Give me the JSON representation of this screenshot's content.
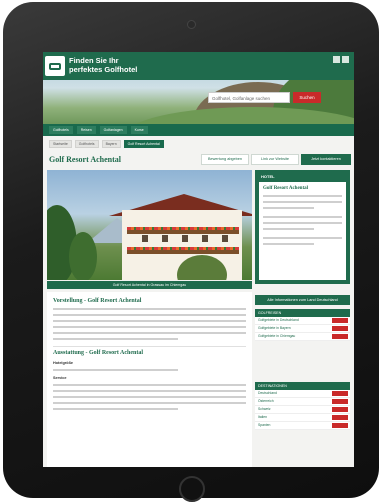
{
  "header": {
    "brand_line1": "Finden Sie Ihr",
    "brand_line2": "perfektes Golfhotel",
    "search_placeholder": "Golfhotel, Golfanlage suchen",
    "search_button": "Suchen"
  },
  "nav": [
    "Golfhotels",
    "Reisen",
    "Golfanlagen",
    "Kurse"
  ],
  "breadcrumbs": [
    "Startseite",
    "Golfhotels",
    "Bayern",
    "Golf Resort Achental"
  ],
  "page": {
    "title": "Golf Resort Achental",
    "btn_rating": "Bewertung abgeben",
    "btn_website": "Link zur Website",
    "btn_contact": "Jetzt kontaktieren"
  },
  "photo_caption": "Golf Resort Achental in Grassau im Chiemgau",
  "sidebar_box": {
    "header": "HOTEL",
    "name": "Golf Resort Achental"
  },
  "content": {
    "section1_title": "Vorstellung - Golf Resort Achental",
    "section2_title": "Ausstattung - Golf Resort Achental",
    "sub1": "Hotelgröße",
    "sub2": "Service"
  },
  "info_button": "Alle Informationen zum Land Deutschland",
  "panel1": {
    "header": "GOLFREISEN",
    "rows": [
      "Golfgebiete in Deutschland",
      "Golfgebiete in Bayern",
      "Golfgebiete in Chiemgau"
    ]
  },
  "panel2": {
    "header": "DESTINATIONEN",
    "rows": [
      "Deutschland",
      "Österreich",
      "Schweiz",
      "Italien",
      "Spanien"
    ]
  }
}
